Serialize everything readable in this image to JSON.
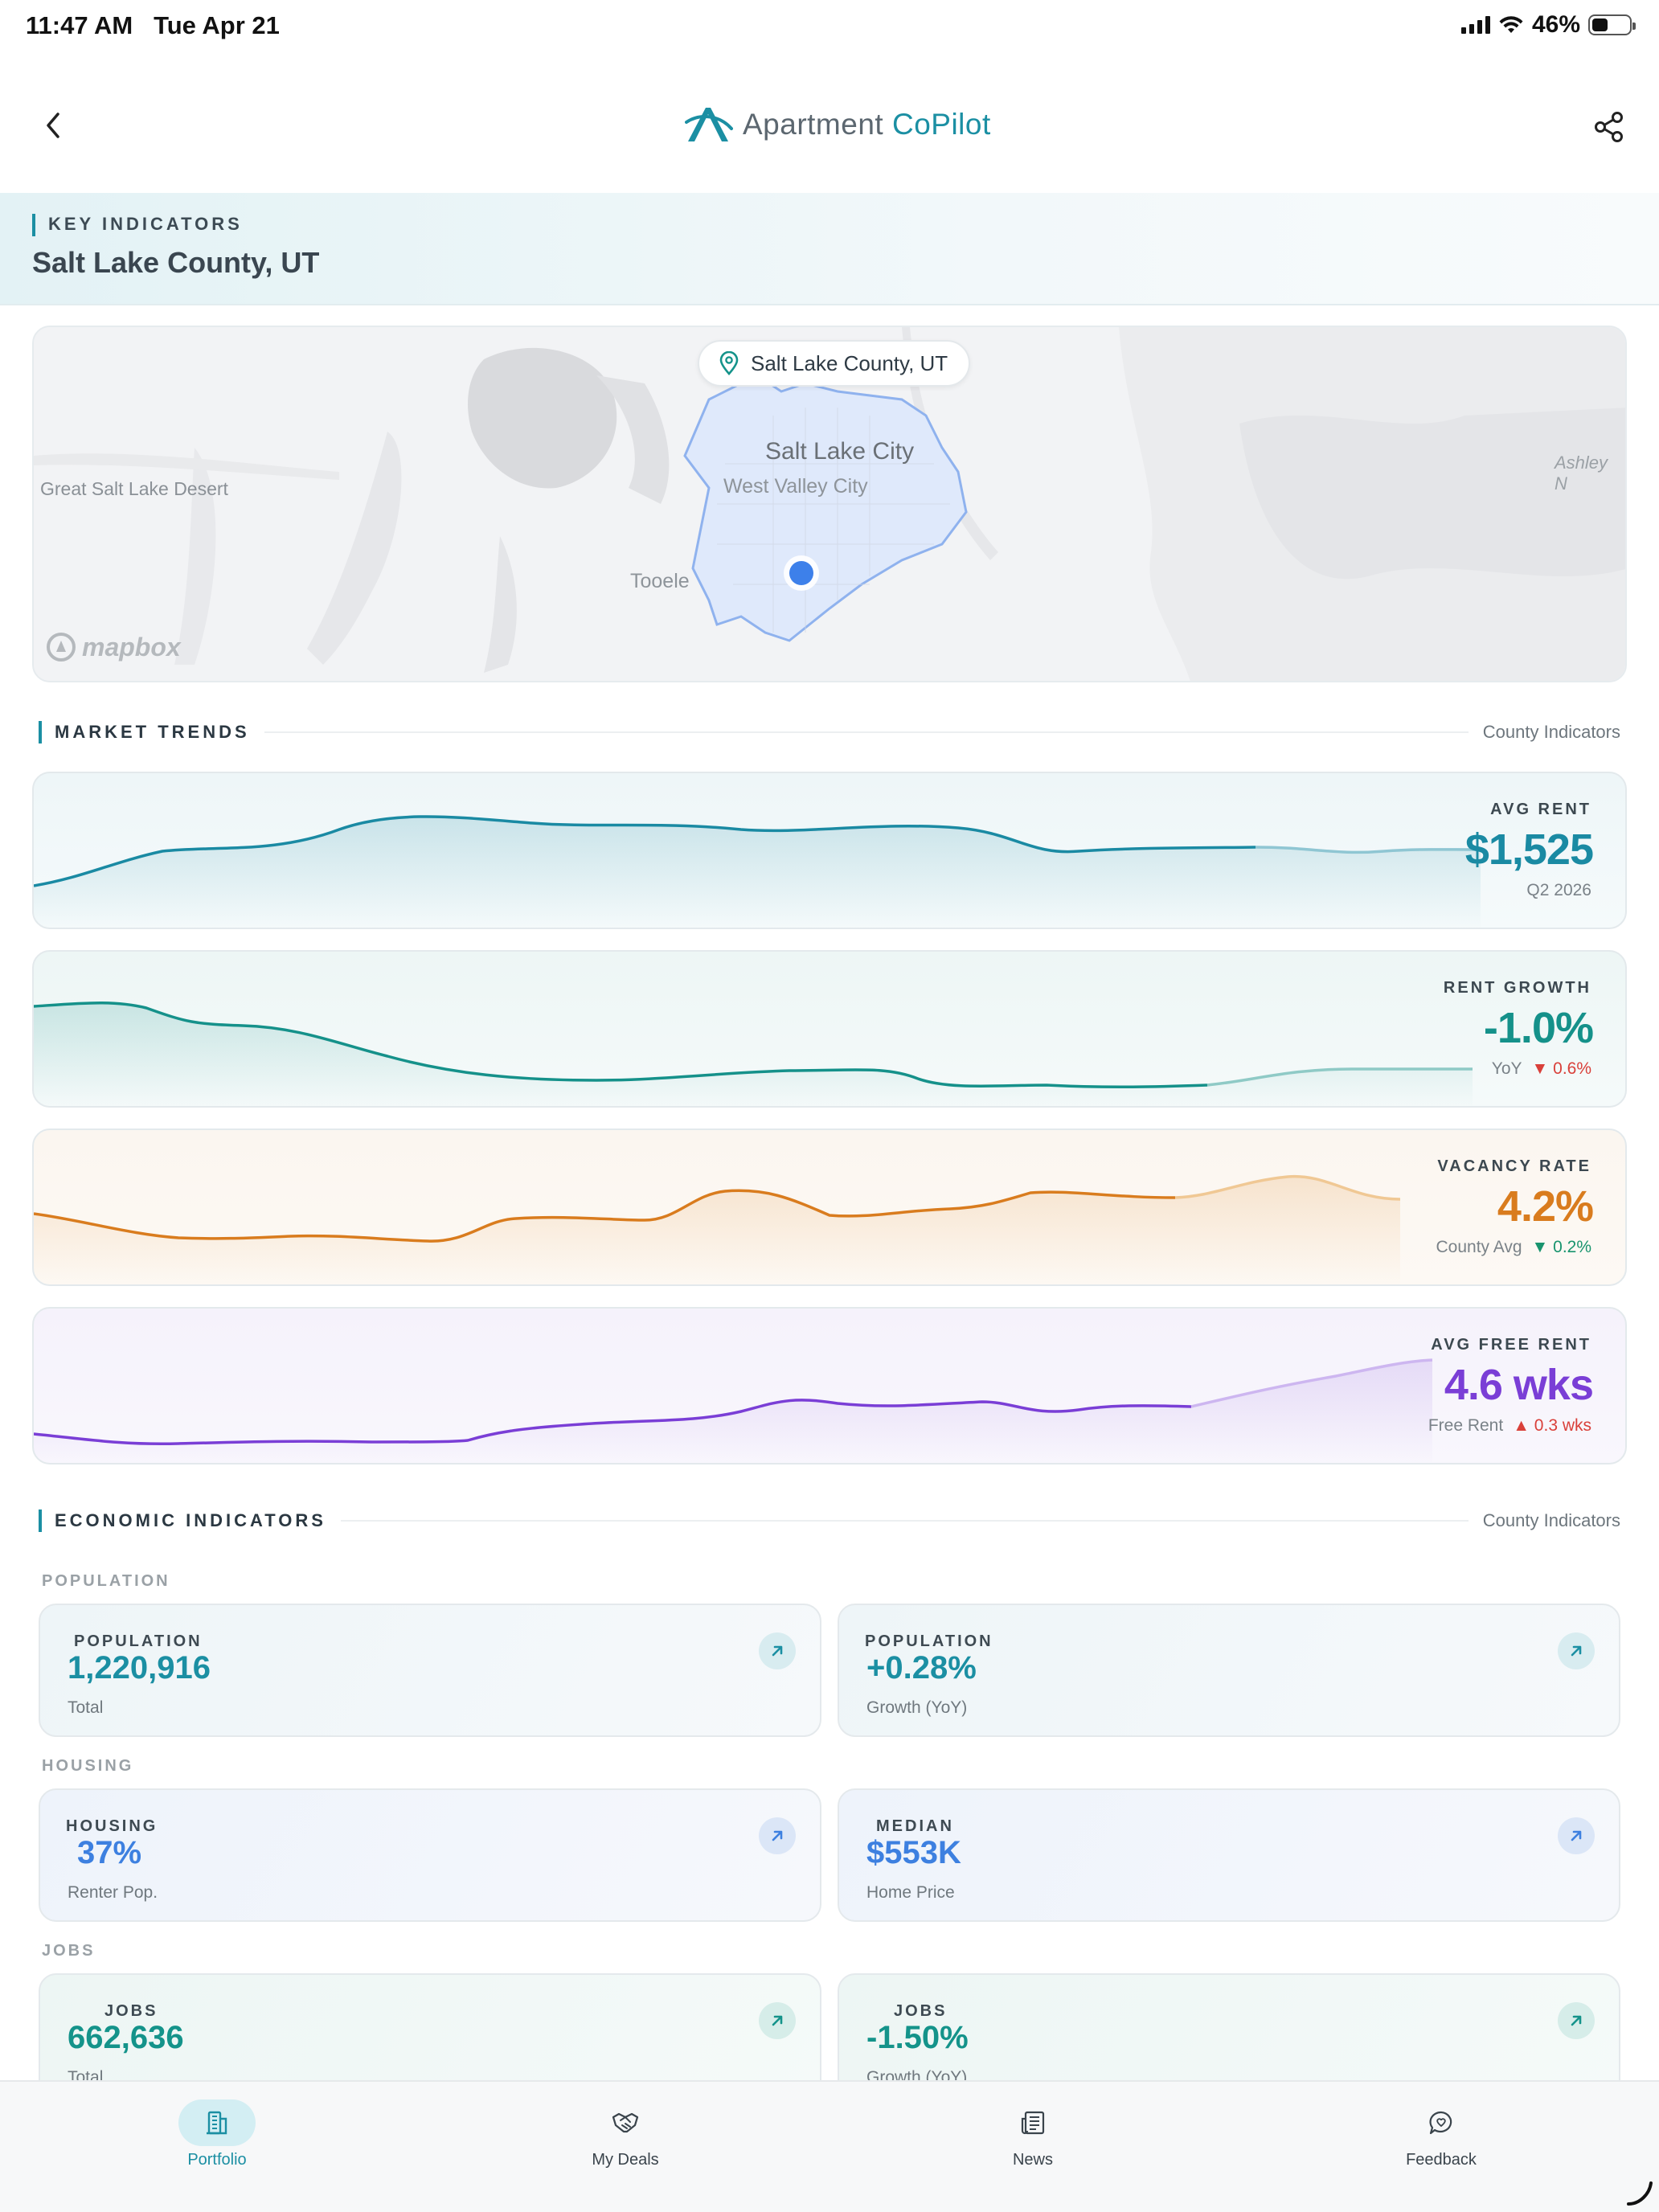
{
  "status_bar": {
    "time": "11:47 AM",
    "date": "Tue Apr 21",
    "battery": "46%"
  },
  "header": {
    "app_name_part1": "Apartment",
    "app_name_part2": "CoPilot"
  },
  "key_indicators": {
    "eyebrow": "KEY INDICATORS",
    "title": "Salt Lake County, UT"
  },
  "map": {
    "chip_label": "Salt Lake County, UT",
    "labels": {
      "city": "Salt Lake City",
      "west_valley": "West Valley City",
      "tooele": "Tooele",
      "desert": "Great Salt Lake Desert",
      "ashley": "Ashley N"
    },
    "attribution": "mapbox"
  },
  "market_trends": {
    "title": "MARKET TRENDS",
    "right_label": "County Indicators",
    "cards": [
      {
        "label": "AVG RENT",
        "value": "$1,525",
        "sub": "Q2 2026",
        "delta": "",
        "color": "#1a8aa3"
      },
      {
        "label": "RENT GROWTH",
        "value": "-1.0%",
        "sub": "YoY",
        "delta": "▼ 0.6%",
        "color": "#15918a"
      },
      {
        "label": "VACANCY RATE",
        "value": "4.2%",
        "sub": "County Avg",
        "delta": "▼ 0.2%",
        "color": "#d97c1e"
      },
      {
        "label": "AVG FREE RENT",
        "value": "4.6 wks",
        "sub": "Free Rent",
        "delta": "▲ 0.3 wks",
        "color": "#7a3ed6"
      }
    ]
  },
  "economic_indicators": {
    "title": "ECONOMIC INDICATORS",
    "right_label": "County Indicators",
    "groups": {
      "population": "POPULATION",
      "housing": "HOUSING",
      "jobs": "JOBS"
    },
    "cards": {
      "pop_total": {
        "label": "POPULATION",
        "value": "1,220,916",
        "sub": "Total"
      },
      "pop_growth": {
        "label": "POPULATION",
        "value": "+0.28%",
        "sub": "Growth (YoY)"
      },
      "housing_renter": {
        "label": "HOUSING",
        "value": "37%",
        "sub": "Renter Pop."
      },
      "median_home": {
        "label": "MEDIAN",
        "value": "$553K",
        "sub": "Home Price"
      },
      "jobs_total": {
        "label": "JOBS",
        "value": "662,636",
        "sub": "Total"
      },
      "jobs_growth": {
        "label": "JOBS",
        "value": "-1.50%",
        "sub": "Growth (YoY)"
      }
    }
  },
  "bottom_nav": {
    "items": [
      {
        "label": "Portfolio",
        "icon": "building-icon",
        "active": true
      },
      {
        "label": "My Deals",
        "icon": "handshake-icon",
        "active": false
      },
      {
        "label": "News",
        "icon": "newspaper-icon",
        "active": false
      },
      {
        "label": "Feedback",
        "icon": "chat-bubble-icon",
        "active": false
      }
    ]
  }
}
